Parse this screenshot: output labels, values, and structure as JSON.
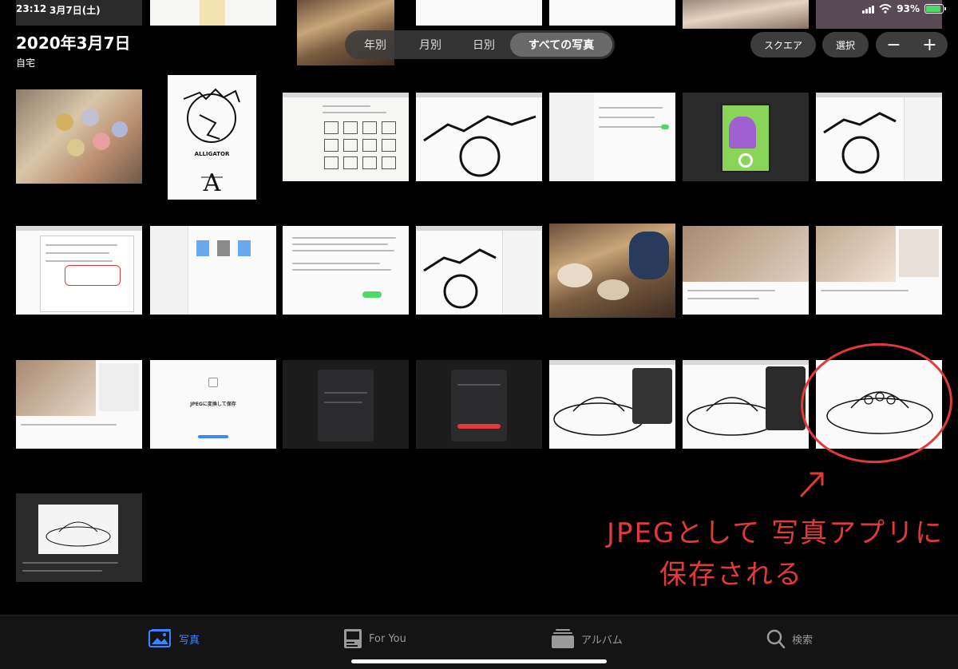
{
  "status": {
    "time": "23:12",
    "date": "3月7日(土)",
    "battery": "93%",
    "battery_level": 0.93
  },
  "header": {
    "title": "2020年3月7日",
    "location": "自宅"
  },
  "segments": {
    "items": [
      "年別",
      "月別",
      "日別",
      "すべての写真"
    ],
    "active": "すべての写真"
  },
  "toolbar": {
    "aspect_label": "スクエア",
    "select_label": "選択",
    "zoom_out": "−",
    "zoom_in": "+"
  },
  "thumbs": {
    "alligator_caption": "ALLIGATOR",
    "alligator_letter": "A",
    "jpeg_text": "JPEGに変換して保存"
  },
  "annotation": {
    "line1": "JPEGとして 写真アプリに",
    "line2": "保存される",
    "color": "#e23a3a"
  },
  "tabs": [
    {
      "label": "写真",
      "icon": "photos-icon",
      "active": true
    },
    {
      "label": "For You",
      "icon": "for-you-icon",
      "active": false
    },
    {
      "label": "アルバム",
      "icon": "albums-icon",
      "active": false
    },
    {
      "label": "検索",
      "icon": "search-icon",
      "active": false
    }
  ],
  "colors": {
    "accent": "#3a86ff",
    "annotation": "#e23a3a"
  }
}
